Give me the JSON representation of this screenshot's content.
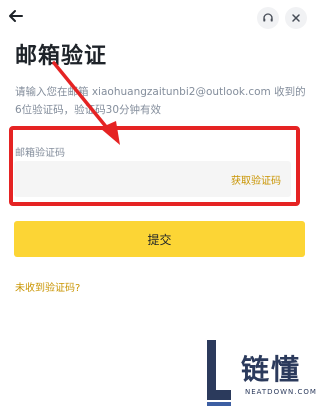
{
  "header": {
    "back_icon": "arrow-left-icon",
    "support_icon": "headset-icon",
    "close_icon": "close-icon"
  },
  "page": {
    "title": "邮箱验证",
    "description": "请输入您在邮箱 xiaohuangzaitunbi2@outlook.com 收到的6位验证码，验证码30分钟有效"
  },
  "form": {
    "code_label": "邮箱验证码",
    "code_value": "",
    "code_placeholder": "",
    "get_code_label": "获取验证码",
    "submit_label": "提交",
    "no_code_label": "未收到验证码?"
  },
  "annotation": {
    "highlight_color": "#e52323"
  },
  "watermark": {
    "brand": "链懂",
    "domain": "NEATDOWN.COM"
  },
  "colors": {
    "accent": "#fcd535",
    "link": "#c99400",
    "text_primary": "#1e2329",
    "text_secondary": "#848e9c"
  }
}
